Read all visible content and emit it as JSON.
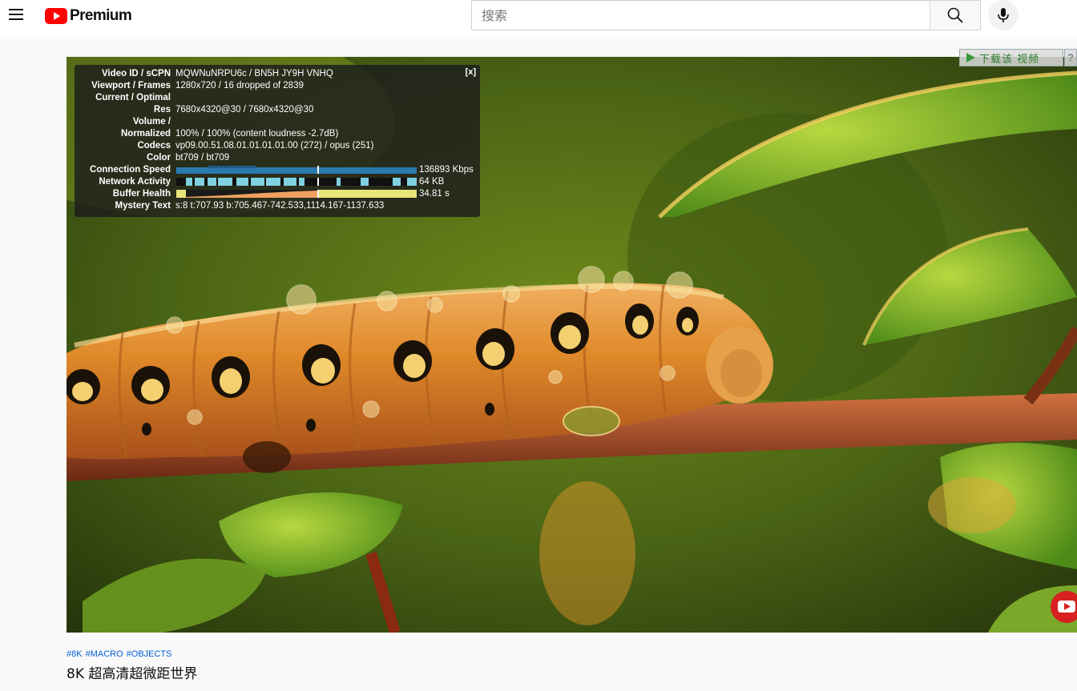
{
  "masthead": {
    "logo_text": "Premium",
    "search_placeholder": "搜索"
  },
  "extension": {
    "download_label": "下载该 视频",
    "help_label": "?"
  },
  "stats": {
    "close_label": "[x]",
    "rows": [
      {
        "label": "Video ID / sCPN",
        "value": "MQWNuNRPU6c / BN5H JY9H VNHQ"
      },
      {
        "label": "Viewport / Frames",
        "value": "1280x720 / 16 dropped of 2839"
      },
      {
        "label": "Current / Optimal",
        "value": ""
      },
      {
        "label": "Res",
        "value": "7680x4320@30 / 7680x4320@30"
      },
      {
        "label": "Volume /",
        "value": ""
      },
      {
        "label": "Normalized",
        "value": "100% / 100% (content loudness -2.7dB)"
      },
      {
        "label": "Codecs",
        "value": "vp09.00.51.08.01.01.01.01.00 (272) / opus (251)"
      },
      {
        "label": "Color",
        "value": "bt709 / bt709"
      },
      {
        "label": "Connection Speed",
        "value": "136893 Kbps"
      },
      {
        "label": "Network Activity",
        "value": "64 KB"
      },
      {
        "label": "Buffer Health",
        "value": "34.81 s"
      },
      {
        "label": "Mystery Text",
        "value": "s:8 t:707.93 b:705.467-742.533,1114.167-1137.633"
      }
    ]
  },
  "video": {
    "hashtags": [
      "#8K",
      "#MACRO",
      "#OBJECTS"
    ],
    "title": "8K 超高清超微距世界"
  },
  "colors": {
    "brand_red": "#ff0000",
    "link_blue": "#065fd4",
    "graph_blue": "#2a7ab0",
    "graph_cyan": "#7fd0e0",
    "graph_yellow": "#e8e57a",
    "graph_orange": "#f0a060"
  }
}
